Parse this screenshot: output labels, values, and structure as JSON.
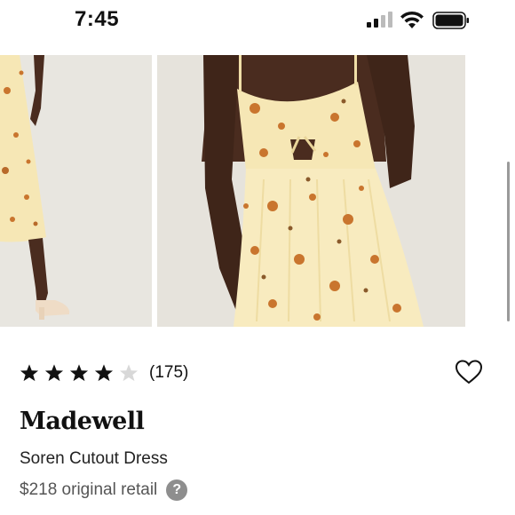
{
  "status_bar": {
    "time": "7:45"
  },
  "gallery": {
    "images": [
      {
        "icon": "product-photo-side-view"
      },
      {
        "icon": "product-photo-front-closeup"
      }
    ]
  },
  "product": {
    "rating": 4,
    "rating_max": 5,
    "review_count": "(175)",
    "brand": "Madewell",
    "name": "Soren Cutout Dress",
    "price": "$218 original retail",
    "help_glyph": "?"
  },
  "colors": {
    "dress_base": "#f5e6b0",
    "flower": "#c9752e",
    "skin": "#4a2c1f",
    "backdrop": "#e6e3dc"
  }
}
